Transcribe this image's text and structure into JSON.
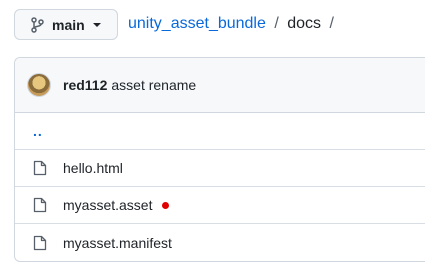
{
  "branch": {
    "label": "main",
    "icon": "git-branch-icon",
    "caret_icon": "triangle-down-icon"
  },
  "breadcrumb": {
    "repo": "unity_asset_bundle",
    "separator": "/",
    "dir": "docs",
    "trailing_separator": "/"
  },
  "commit": {
    "author": "red112",
    "message": "asset rename"
  },
  "parent_link": "..",
  "files": [
    {
      "name": "hello.html",
      "icon": "file-icon",
      "modified": false
    },
    {
      "name": "myasset.asset",
      "icon": "file-icon",
      "modified": true
    },
    {
      "name": "myasset.manifest",
      "icon": "file-icon",
      "modified": false
    }
  ],
  "colors": {
    "link": "#0969da",
    "border": "#d0d7de",
    "header_bg": "#f6f8fa",
    "dot": "#e00000"
  }
}
